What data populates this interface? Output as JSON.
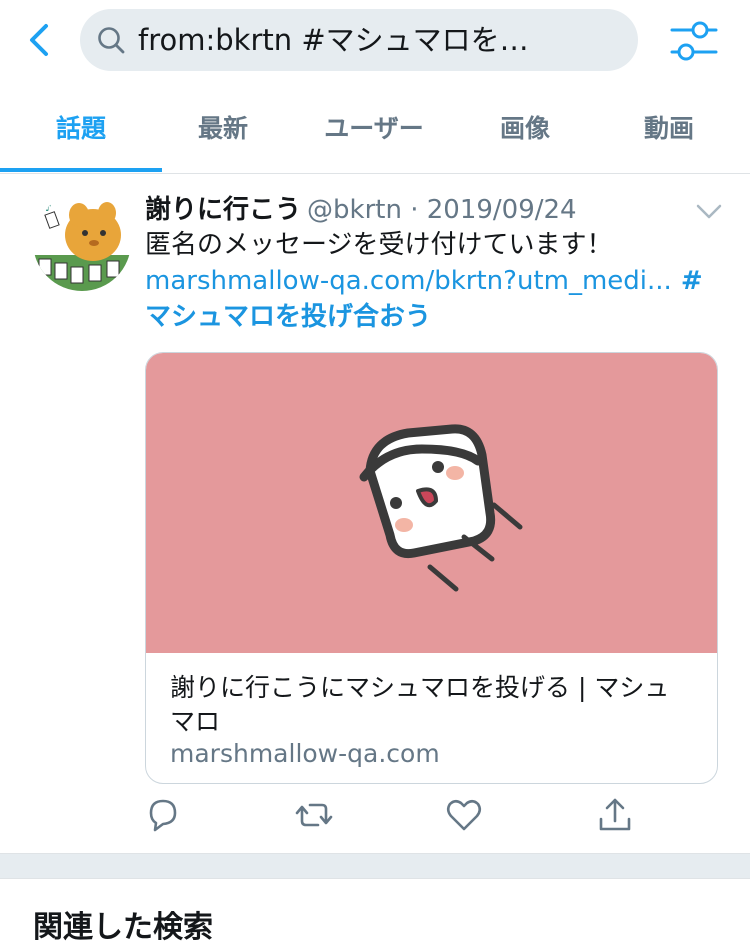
{
  "search": {
    "query": "from:bkrtn #マシュマロを…"
  },
  "tabs": [
    {
      "label": "話題",
      "active": true
    },
    {
      "label": "最新",
      "active": false
    },
    {
      "label": "ユーザー",
      "active": false
    },
    {
      "label": "画像",
      "active": false
    },
    {
      "label": "動画",
      "active": false
    }
  ],
  "tweet": {
    "author_name": "謝りに行こう",
    "meta": "@bkrtn · 2019/09/24",
    "text_line1": "匿名のメッセージを受け付けています！",
    "link": " marshmallow-qa.com/bkrtn?utm_medi...",
    "hashtag_part1": " #",
    "hashtag_part2": "マシュマロを投げ合おう",
    "card": {
      "title": "謝りに行こうにマシュマロを投げる | マシュマロ",
      "domain": "marshmallow-qa.com"
    }
  },
  "related": {
    "title": "関連した検索"
  },
  "colors": {
    "accent": "#1da1f2",
    "card_bg": "#e4999b",
    "secondary_text": "#657786"
  },
  "icons": [
    "back-chevron-icon",
    "search-icon",
    "filter-sliders-icon",
    "caret-down-icon",
    "reply-icon",
    "retweet-icon",
    "like-icon",
    "share-icon"
  ]
}
